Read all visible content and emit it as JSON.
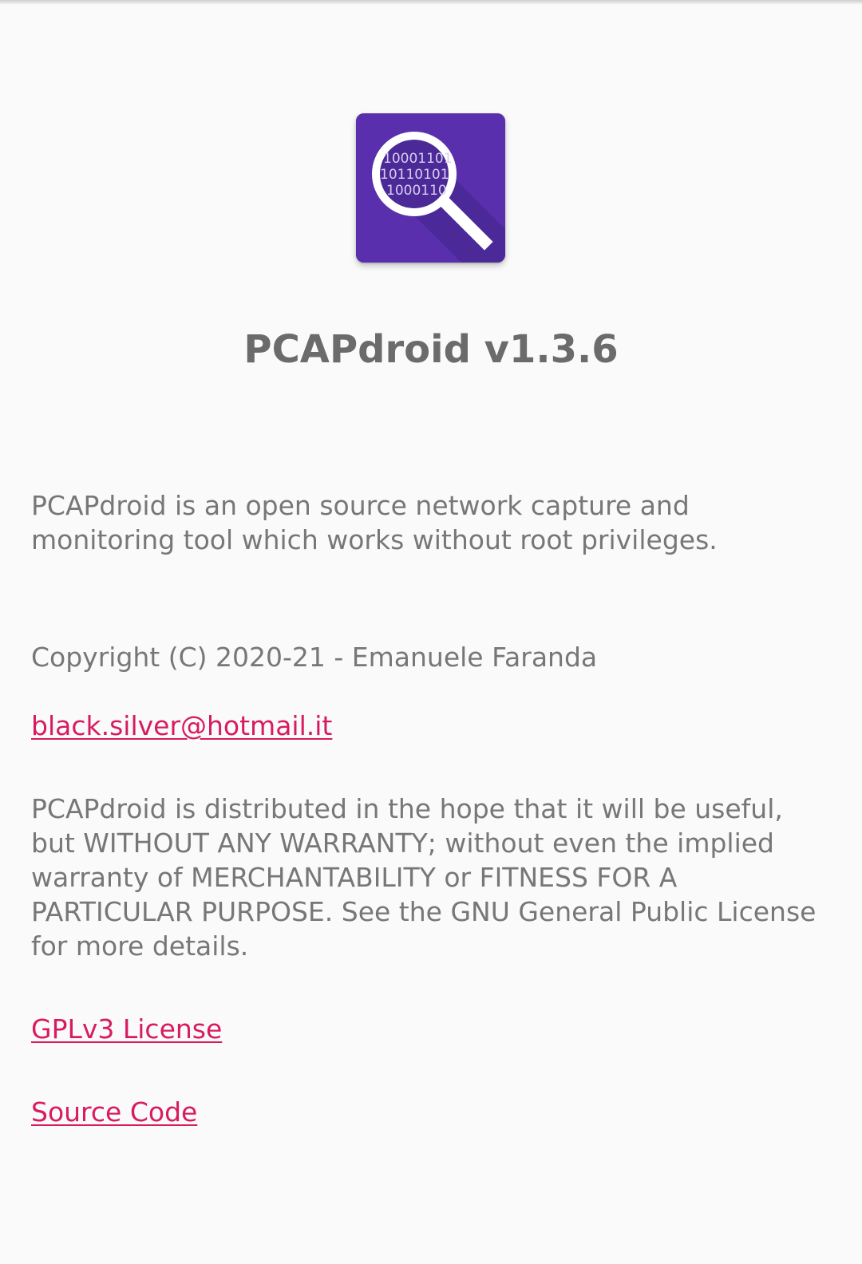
{
  "app": {
    "title": "PCAPdroid v1.3.6",
    "icon_name": "pcapdroid-app-icon",
    "icon_binary_lines": [
      "10001101",
      "10110101",
      "1000110"
    ]
  },
  "about": {
    "description": "PCAPdroid is an open source network capture and\nmonitoring tool which works without root privileges.",
    "copyright": "Copyright (C) 2020-21 - Emanuele Faranda",
    "email": "black.silver@hotmail.it",
    "warranty": "PCAPdroid is distributed in the hope that it will be useful,\nbut WITHOUT ANY WARRANTY; without even the implied\nwarranty of MERCHANTABILITY or FITNESS FOR A\nPARTICULAR PURPOSE. See the GNU General Public License\nfor more details.",
    "license_link": "GPLv3 License",
    "source_link": "Source Code"
  },
  "colors": {
    "background": "#fafafa",
    "text": "#777777",
    "title": "#6b6b6b",
    "link": "#d81b60",
    "icon_primary": "#5a2fae",
    "icon_shadow": "#3f2589"
  }
}
